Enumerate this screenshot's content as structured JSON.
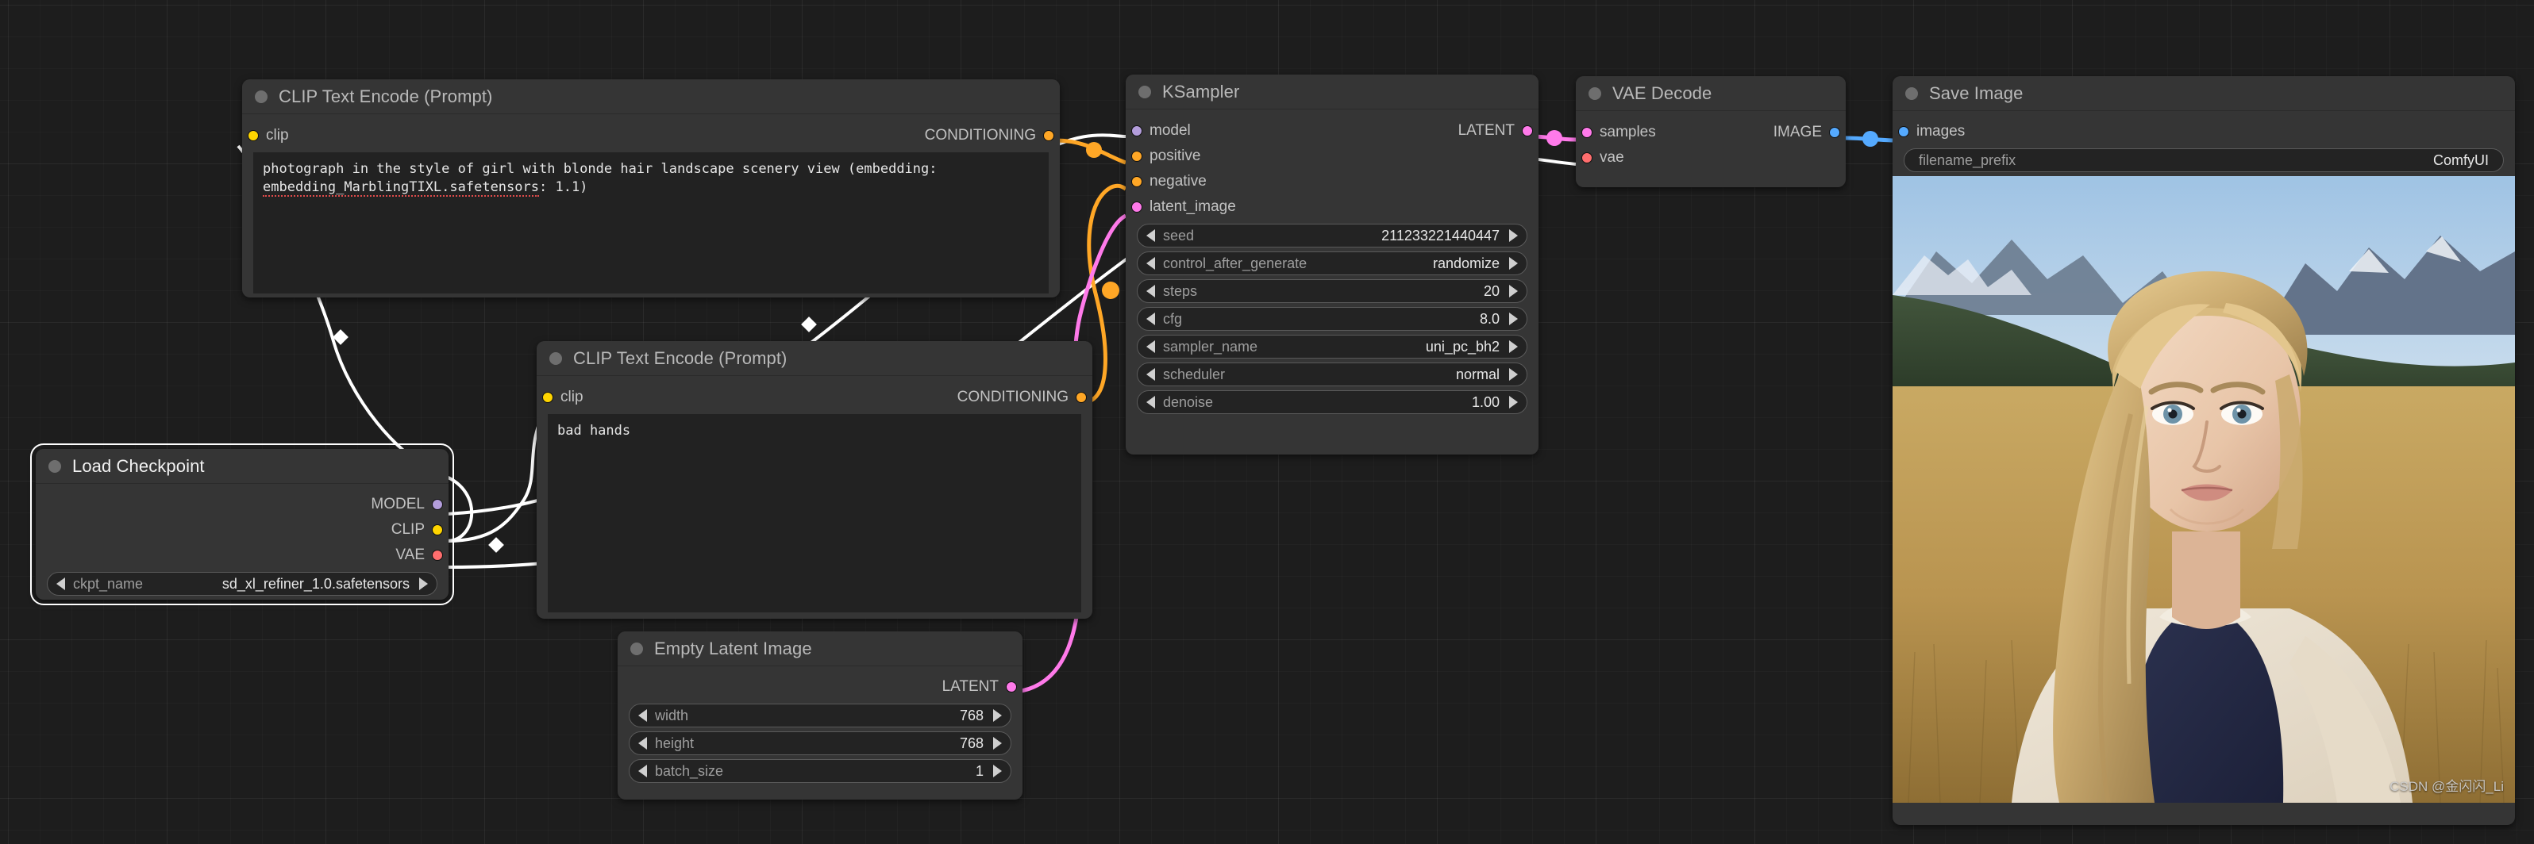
{
  "canvas": {
    "background_color": "#1d1d1d",
    "grid": true
  },
  "watermark": {
    "text": "CSDN @金闪闪_Li"
  },
  "colors": {
    "clip": "#FFD500",
    "model": "#B39DDB",
    "vae": "#FF6E6E",
    "conditioning": "#FFA726",
    "latent": "#FF7AEA",
    "image": "#55AAFF",
    "link_default": "#FFFFFF"
  },
  "nodes": {
    "clip_positive": {
      "title": "CLIP Text Encode (Prompt)",
      "input_clip": "clip",
      "output_conditioning": "CONDITIONING",
      "text": "photograph in the style of girl with blonde hair landscape scenery view (embedding: embedding_MarblingTIXL.safetensors: 1.1)",
      "text_line1": "photograph in the style of girl with blonde hair landscape scenery view (embedding:",
      "text_spell": "embedding_MarblingTIXL.safetensors",
      "text_tail": ": 1.1)"
    },
    "clip_negative": {
      "title": "CLIP Text Encode (Prompt)",
      "input_clip": "clip",
      "output_conditioning": "CONDITIONING",
      "text": "bad hands"
    },
    "load_checkpoint": {
      "title": "Load Checkpoint",
      "outputs": [
        "MODEL",
        "CLIP",
        "VAE"
      ],
      "widget": {
        "label": "ckpt_name",
        "value": "sd_xl_refiner_1.0.safetensors"
      }
    },
    "empty_latent": {
      "title": "Empty Latent Image",
      "output_latent": "LATENT",
      "widgets": [
        {
          "label": "width",
          "value": "768"
        },
        {
          "label": "height",
          "value": "768"
        },
        {
          "label": "batch_size",
          "value": "1"
        }
      ]
    },
    "ksampler": {
      "title": "KSampler",
      "inputs": [
        "model",
        "positive",
        "negative",
        "latent_image"
      ],
      "output_latent": "LATENT",
      "widgets": [
        {
          "label": "seed",
          "value": "211233221440447"
        },
        {
          "label": "control_after_generate",
          "value": "randomize"
        },
        {
          "label": "steps",
          "value": "20"
        },
        {
          "label": "cfg",
          "value": "8.0"
        },
        {
          "label": "sampler_name",
          "value": "uni_pc_bh2"
        },
        {
          "label": "scheduler",
          "value": "normal"
        },
        {
          "label": "denoise",
          "value": "1.00"
        }
      ]
    },
    "vae_decode": {
      "title": "VAE Decode",
      "inputs": [
        "samples",
        "vae"
      ],
      "output_image": "IMAGE"
    },
    "save_image": {
      "title": "Save Image",
      "input_images": "images",
      "widget": {
        "label": "filename_prefix",
        "value": "ComfyUI"
      }
    }
  }
}
